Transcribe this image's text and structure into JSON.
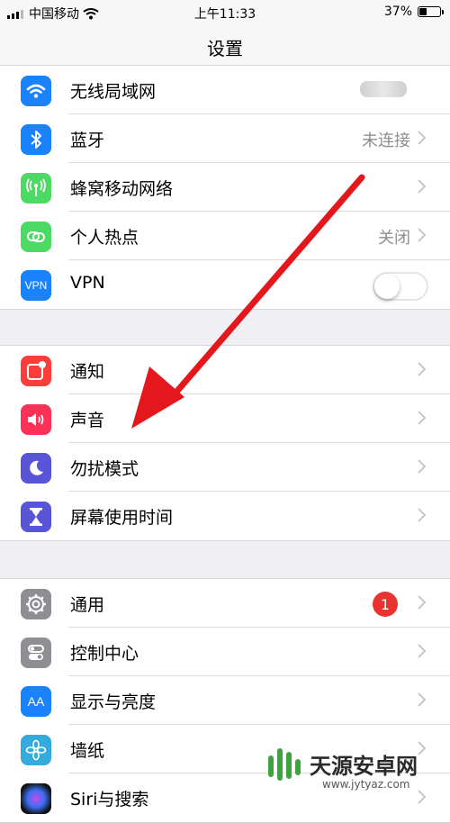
{
  "status": {
    "carrier": "中国移动",
    "time": "上午11:33",
    "battery_text": "37%",
    "battery_level": 0.37
  },
  "nav": {
    "title": "设置"
  },
  "group1": [
    {
      "label": "无线局域网",
      "icon": "wifi-icon",
      "color": "#1a82fb",
      "value": "",
      "blurred": true
    },
    {
      "label": "蓝牙",
      "icon": "bluetooth-icon",
      "color": "#1a82fb",
      "value": "未连接"
    },
    {
      "label": "蜂窝移动网络",
      "icon": "antenna-icon",
      "color": "#4cd964",
      "value": ""
    },
    {
      "label": "个人热点",
      "icon": "hotspot-icon",
      "color": "#4cd964",
      "value": "关闭"
    },
    {
      "label": "VPN",
      "icon": "vpn-icon",
      "color": "#1a82fb",
      "icon_text": "VPN",
      "toggle_on": false
    }
  ],
  "group2": [
    {
      "label": "通知",
      "icon": "notification-icon",
      "color": "#fc3d39"
    },
    {
      "label": "声音",
      "icon": "speaker-icon",
      "color": "#fc3158"
    },
    {
      "label": "勿扰模式",
      "icon": "moon-icon",
      "color": "#5856d6"
    },
    {
      "label": "屏幕使用时间",
      "icon": "hourglass-icon",
      "color": "#5856d6"
    }
  ],
  "group3": [
    {
      "label": "通用",
      "icon": "gear-icon",
      "color": "#8e8e93",
      "badge": "1"
    },
    {
      "label": "控制中心",
      "icon": "control-center-icon",
      "color": "#8e8e93"
    },
    {
      "label": "显示与亮度",
      "icon": "display-icon",
      "color": "#1a82fb",
      "icon_text": "AA"
    },
    {
      "label": "墙纸",
      "icon": "wallpaper-icon",
      "color": "#35aadc"
    },
    {
      "label": "Siri与搜索",
      "icon": "siri-icon",
      "color": "#222222"
    }
  ],
  "watermark": {
    "text": "天源安卓网",
    "url": "www.jytyaz.com"
  },
  "colors": {
    "arrow": "#e4181c",
    "accent": "#1a82fb",
    "badge": "#e8332f"
  }
}
